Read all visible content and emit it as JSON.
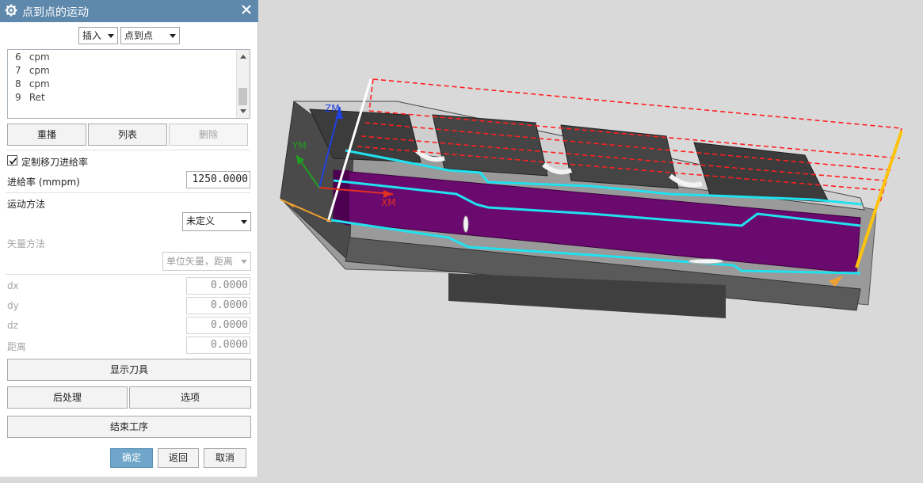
{
  "dialog": {
    "title": "点到点的运动",
    "insert_dropdown": "插入",
    "mode_dropdown": "点到点",
    "list_items": [
      {
        "num": "6",
        "text": "cpm"
      },
      {
        "num": "7",
        "text": "cpm"
      },
      {
        "num": "8",
        "text": "cpm"
      },
      {
        "num": "9",
        "text": "Ret"
      }
    ],
    "replay_button": "重播",
    "list_button": "列表",
    "delete_button": "删除",
    "custom_feed_checkbox": "定制移刀进给率",
    "feed_rate_label": "进给率 (mmpm)",
    "feed_rate_value": "1250.0000",
    "motion_method_label": "运动方法",
    "motion_method_value": "未定义",
    "vector_method_label": "矢量方法",
    "vector_method_value": "单位矢量，距离",
    "dx_label": "dx",
    "dx_value": "0.0000",
    "dy_label": "dy",
    "dy_value": "0.0000",
    "dz_label": "dz",
    "dz_value": "0.0000",
    "distance_label": "距离",
    "distance_value": "0.0000",
    "show_tool_button": "显示刀具",
    "post_process_button": "后处理",
    "options_button": "选项",
    "end_operation_button": "结束工序",
    "ok_button": "确定",
    "back_button": "返回",
    "cancel_button": "取消"
  },
  "viewport": {
    "axis_zm": "ZM",
    "axis_ym": "YM",
    "axis_xm": "XM"
  },
  "colors": {
    "title_bar": "#5f89ac",
    "ok_button": "#6fa6c9",
    "toolpath_cyan": "#21e1ef",
    "rapid_red": "#ff2020",
    "pocket_floor": "#6a0a6e",
    "tool_axis_yellow": "#ffc20e"
  }
}
